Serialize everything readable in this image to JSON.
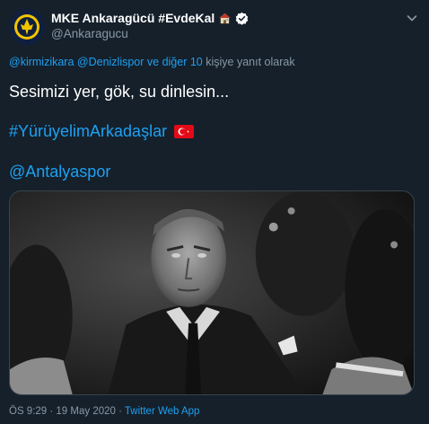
{
  "account": {
    "display_name": "MKE Ankaragücü #EvdeKal",
    "handle": "@Ankaragucu",
    "avatar_icon": "club-crest-icon",
    "name_emoji_icon": "house-icon",
    "verified_icon": "verified-badge-icon"
  },
  "reply": {
    "mention1": "@kirmizikara",
    "mention2": "@Denizlispor ve diğer 10",
    "suffix": "kişiye yanıt olarak"
  },
  "tweet": {
    "line1": "Sesimizi yer, gök, su dinlesin...",
    "hashtag": "#YürüyelimArkadaşlar",
    "flag_icon": "turkey-flag-icon",
    "mention": "@Antalyaspor"
  },
  "media": {
    "type": "photo",
    "tone": "black-and-white portrait"
  },
  "meta": {
    "timestamp": "ÖS 9:29 · 19 May 2020 · ",
    "source": "Twitter Web App"
  },
  "colors": {
    "background": "#15202b",
    "link": "#1da1f2",
    "secondary_text": "#8899a6",
    "primary_text": "#ffffff"
  }
}
